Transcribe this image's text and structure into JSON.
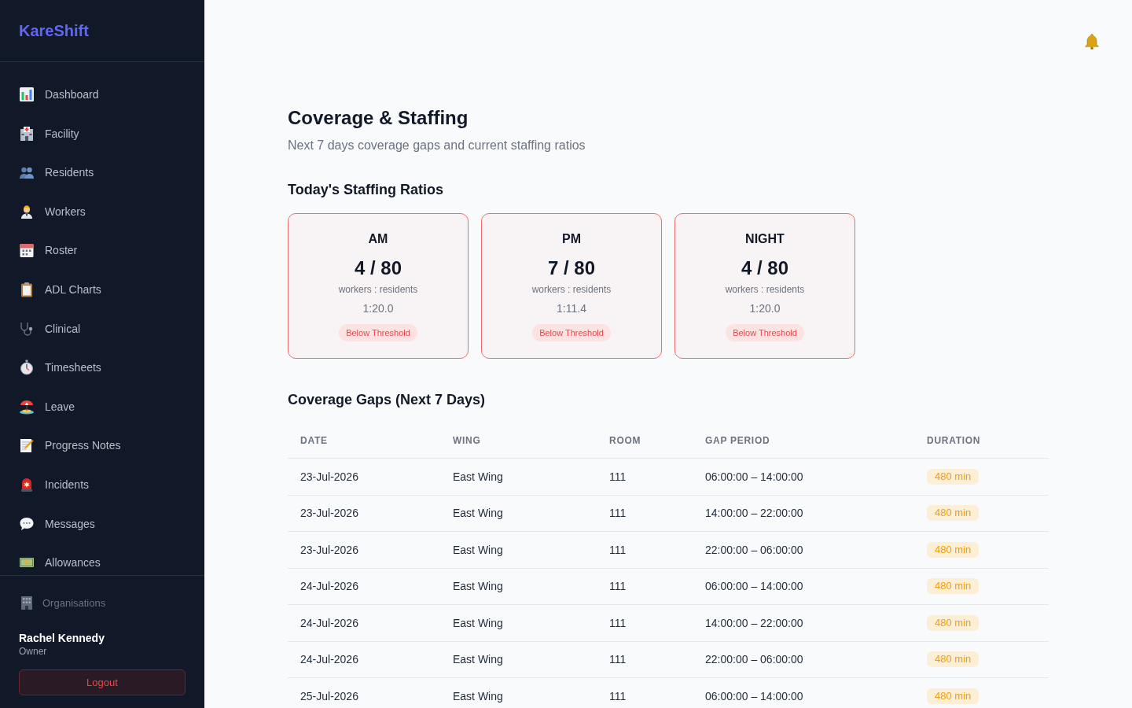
{
  "sidebar": {
    "logo": "KareShift",
    "nav_items": [
      {
        "label": "Dashboard",
        "selected": false
      },
      {
        "label": "Facility",
        "selected": false
      },
      {
        "label": "Residents",
        "selected": false
      },
      {
        "label": "Workers",
        "selected": false
      },
      {
        "label": "Roster",
        "selected": false
      },
      {
        "label": "ADL Charts",
        "selected": false
      },
      {
        "label": "Clinical",
        "selected": false
      },
      {
        "label": "Timesheets",
        "selected": false
      },
      {
        "label": "Leave",
        "selected": false
      },
      {
        "label": "Progress Notes",
        "selected": false
      },
      {
        "label": "Incidents",
        "selected": false
      },
      {
        "label": "Messages",
        "selected": false
      },
      {
        "label": "Allowances",
        "selected": false
      }
    ],
    "footer": {
      "link": "Organisations",
      "user": {
        "name": "Rachel Kennedy",
        "role": "Owner"
      },
      "logout_button": "Logout"
    }
  },
  "page": {
    "title": "Coverage & Staffing",
    "subtitle": "Next 7 days coverage gaps and current staffing ratios"
  },
  "staffing_ratios": {
    "heading": "Today's Staffing Ratios",
    "cards": [
      {
        "shift": "AM",
        "count": "4 / 80",
        "caption": "workers : residents",
        "ratio": "1:20.0",
        "below_threshold": true,
        "badge": "Below Threshold"
      },
      {
        "shift": "PM",
        "count": "7 / 80",
        "caption": "workers : residents",
        "ratio": "1:11.4",
        "below_threshold": true,
        "badge": "Below Threshold"
      },
      {
        "shift": "NIGHT",
        "count": "4 / 80",
        "caption": "workers : residents",
        "ratio": "1:20.0",
        "below_threshold": true,
        "badge": "Below Threshold"
      }
    ]
  },
  "coverage_gaps": {
    "heading": "Coverage Gaps (Next 7 Days)",
    "table": {
      "columns": [
        "DATE",
        "WING",
        "ROOM",
        "GAP PERIOD",
        "DURATION"
      ],
      "rows": [
        {
          "date": "23-Jul-2026",
          "wing": "East Wing",
          "room": "111",
          "gap_period": "06:00:00 – 14:00:00",
          "duration": "480 min"
        },
        {
          "date": "23-Jul-2026",
          "wing": "East Wing",
          "room": "111",
          "gap_period": "14:00:00 – 22:00:00",
          "duration": "480 min"
        },
        {
          "date": "23-Jul-2026",
          "wing": "East Wing",
          "room": "111",
          "gap_period": "22:00:00 – 06:00:00",
          "duration": "480 min"
        },
        {
          "date": "24-Jul-2026",
          "wing": "East Wing",
          "room": "111",
          "gap_period": "06:00:00 – 14:00:00",
          "duration": "480 min"
        },
        {
          "date": "24-Jul-2026",
          "wing": "East Wing",
          "room": "111",
          "gap_period": "14:00:00 – 22:00:00",
          "duration": "480 min"
        },
        {
          "date": "24-Jul-2026",
          "wing": "East Wing",
          "room": "111",
          "gap_period": "22:00:00 – 06:00:00",
          "duration": "480 min"
        },
        {
          "date": "25-Jul-2026",
          "wing": "East Wing",
          "room": "111",
          "gap_period": "06:00:00 – 14:00:00",
          "duration": "480 min"
        }
      ]
    }
  }
}
